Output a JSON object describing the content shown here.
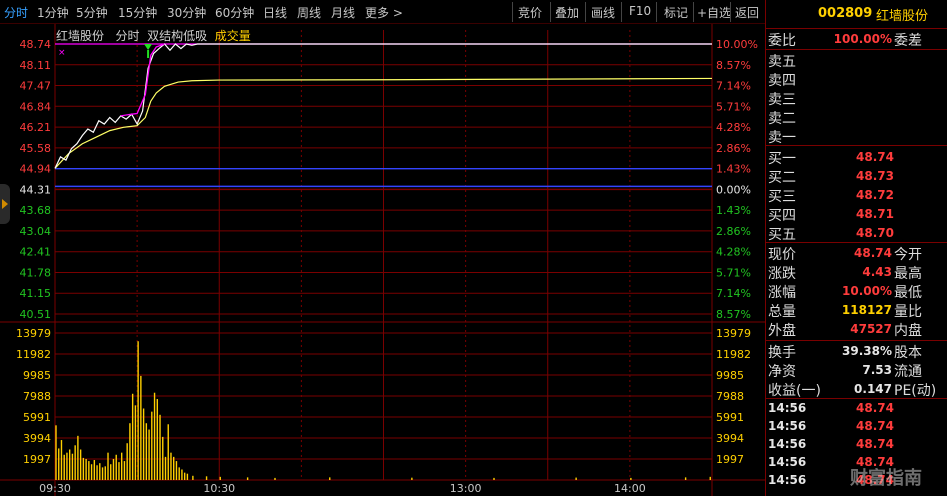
{
  "toolbar": {
    "periods": [
      "分时",
      "1分钟",
      "5分钟",
      "15分钟",
      "30分钟",
      "60分钟",
      "日线",
      "周线",
      "月线",
      "更多 >"
    ],
    "actions": [
      "竞价",
      "叠加",
      "画线",
      "F10",
      "标记",
      "+自选",
      "返回"
    ]
  },
  "chart_title": {
    "stock": "红墙股份",
    "mode": "分时",
    "indicator": "双结构低吸",
    "volume_label": "成交量"
  },
  "chart_data": {
    "type": "line",
    "price_axis_left": [
      "48.74",
      "48.11",
      "47.47",
      "46.84",
      "46.21",
      "45.58",
      "44.94",
      "44.31",
      "43.68",
      "43.04",
      "42.41",
      "41.78",
      "41.15",
      "40.51"
    ],
    "pct_axis_right": [
      "10.00%",
      "8.57%",
      "7.14%",
      "5.71%",
      "4.28%",
      "2.86%",
      "1.43%",
      "0.00%",
      "1.43%",
      "2.86%",
      "4.28%",
      "5.71%",
      "7.14%",
      "8.57%"
    ],
    "volume_axis": [
      "13979",
      "11982",
      "9985",
      "7988",
      "5991",
      "3994",
      "1997"
    ],
    "x_labels": [
      "09:30",
      "10:30",
      "13:00",
      "14:00"
    ],
    "prev_close": 44.31,
    "limit_up": 48.74,
    "price_series": [
      [
        0,
        44.95
      ],
      [
        2,
        45.3
      ],
      [
        4,
        45.2
      ],
      [
        6,
        45.55
      ],
      [
        8,
        45.7
      ],
      [
        10,
        45.95
      ],
      [
        12,
        46.15
      ],
      [
        14,
        46.05
      ],
      [
        16,
        46.4
      ],
      [
        18,
        46.3
      ],
      [
        20,
        46.5
      ],
      [
        22,
        46.35
      ],
      [
        24,
        46.55
      ],
      [
        26,
        46.45
      ],
      [
        28,
        46.6
      ],
      [
        30,
        46.3
      ],
      [
        32,
        46.7
      ],
      [
        34,
        48.0
      ],
      [
        36,
        48.45
      ],
      [
        38,
        48.6
      ],
      [
        40,
        48.74
      ],
      [
        42,
        48.55
      ],
      [
        44,
        48.74
      ],
      [
        46,
        48.6
      ],
      [
        48,
        48.74
      ],
      [
        50,
        48.7
      ],
      [
        52,
        48.74
      ],
      [
        240,
        48.74
      ]
    ],
    "avg_series": [
      [
        0,
        44.95
      ],
      [
        5,
        45.4
      ],
      [
        10,
        45.7
      ],
      [
        15,
        45.9
      ],
      [
        20,
        46.1
      ],
      [
        25,
        46.2
      ],
      [
        30,
        46.25
      ],
      [
        33,
        46.5
      ],
      [
        35,
        47.0
      ],
      [
        37,
        47.25
      ],
      [
        40,
        47.45
      ],
      [
        45,
        47.58
      ],
      [
        50,
        47.62
      ],
      [
        60,
        47.64
      ],
      [
        120,
        47.65
      ],
      [
        180,
        47.67
      ],
      [
        240,
        47.69
      ]
    ],
    "volume_series": [
      [
        0,
        5200
      ],
      [
        1,
        3000
      ],
      [
        2,
        3800
      ],
      [
        3,
        2400
      ],
      [
        4,
        2600
      ],
      [
        5,
        2900
      ],
      [
        6,
        2500
      ],
      [
        7,
        3300
      ],
      [
        8,
        4200
      ],
      [
        9,
        2900
      ],
      [
        10,
        2100
      ],
      [
        11,
        2000
      ],
      [
        12,
        1800
      ],
      [
        13,
        1500
      ],
      [
        14,
        1900
      ],
      [
        15,
        1400
      ],
      [
        16,
        1600
      ],
      [
        17,
        1200
      ],
      [
        18,
        1300
      ],
      [
        19,
        2600
      ],
      [
        20,
        1500
      ],
      [
        21,
        2000
      ],
      [
        22,
        2400
      ],
      [
        23,
        1700
      ],
      [
        24,
        2600
      ],
      [
        25,
        1800
      ],
      [
        26,
        3500
      ],
      [
        27,
        5400
      ],
      [
        28,
        8200
      ],
      [
        29,
        7100
      ],
      [
        30,
        13200
      ],
      [
        31,
        9900
      ],
      [
        32,
        6800
      ],
      [
        33,
        5400
      ],
      [
        34,
        4800
      ],
      [
        35,
        6500
      ],
      [
        36,
        8300
      ],
      [
        37,
        7700
      ],
      [
        38,
        6200
      ],
      [
        39,
        4100
      ],
      [
        40,
        2200
      ],
      [
        41,
        5300
      ],
      [
        42,
        2600
      ],
      [
        43,
        2200
      ],
      [
        44,
        1800
      ],
      [
        45,
        1200
      ],
      [
        46,
        1000
      ],
      [
        47,
        700
      ],
      [
        48,
        600
      ],
      [
        50,
        400
      ],
      [
        55,
        350
      ],
      [
        60,
        300
      ],
      [
        70,
        250
      ],
      [
        80,
        200
      ],
      [
        100,
        250
      ],
      [
        130,
        220
      ],
      [
        160,
        200
      ],
      [
        190,
        230
      ],
      [
        210,
        200
      ],
      [
        230,
        250
      ],
      [
        239,
        300
      ]
    ],
    "colors": {
      "price": "#ffffff",
      "avg": "#ffff66",
      "limit": "#ff00ff",
      "prev_close": "#3344ff",
      "grid": "#7a0000",
      "up": "#ff3c3c",
      "down": "#21c421",
      "volume": "#ffd000"
    }
  },
  "panel": {
    "code": "002809",
    "name": "红墙股份",
    "weibi_label": "委比",
    "weibi_value": "100.00%",
    "weicha_label": "委差",
    "sell_labels": [
      "卖五",
      "卖四",
      "卖三",
      "卖二",
      "卖一"
    ],
    "buy_labels": [
      "买一",
      "买二",
      "买三",
      "买四",
      "买五"
    ],
    "buy_prices": [
      "48.74",
      "48.73",
      "48.72",
      "48.71",
      "48.70"
    ],
    "quote": [
      {
        "label": "现价",
        "value": "48.74",
        "label2": "今开",
        "color": "red"
      },
      {
        "label": "涨跌",
        "value": "4.43",
        "label2": "最高",
        "color": "red"
      },
      {
        "label": "涨幅",
        "value": "10.00%",
        "label2": "最低",
        "color": "red"
      },
      {
        "label": "总量",
        "value": "118127",
        "label2": "量比",
        "color": "yellow"
      },
      {
        "label": "外盘",
        "value": "47527",
        "label2": "内盘",
        "color": "red"
      }
    ],
    "stats": [
      {
        "label": "换手",
        "value": "39.38%",
        "label2": "股本"
      },
      {
        "label": "净资",
        "value": "7.53",
        "label2": "流通"
      },
      {
        "label": "收益(一)",
        "value": "0.147",
        "label2": "PE(动)"
      }
    ],
    "ticks": [
      {
        "time": "14:56",
        "price": "48.74"
      },
      {
        "time": "14:56",
        "price": "48.74"
      },
      {
        "time": "14:56",
        "price": "48.74"
      },
      {
        "time": "14:56",
        "price": "48.74"
      },
      {
        "time": "14:56",
        "price": "48.74"
      }
    ]
  },
  "watermark": "财富指南"
}
